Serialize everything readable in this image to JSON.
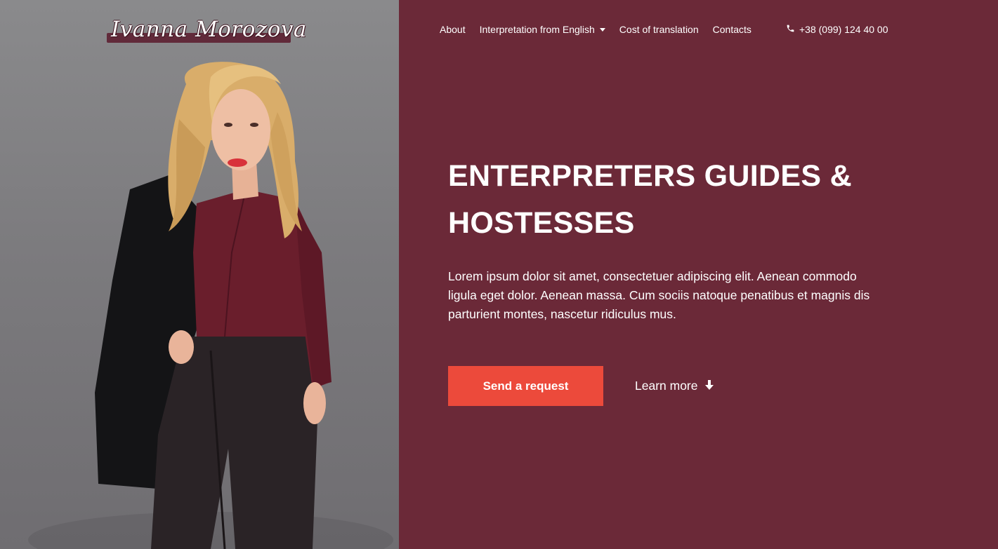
{
  "logo": {
    "text": "Ivanna Morozova"
  },
  "nav": {
    "items": [
      {
        "label": "About"
      },
      {
        "label": "Interpretation from English",
        "has_dropdown": true
      },
      {
        "label": "Cost of translation"
      },
      {
        "label": "Contacts"
      }
    ],
    "phone": "+38 (099) 124 40 00"
  },
  "hero": {
    "title": "ENTERPRETERS GUIDES & HOSTESSES",
    "text": "Lorem ipsum dolor sit amet, consectetuer adipiscing elit. Aenean commodo ligula eget dolor. Aenean massa. Cum sociis natoque penatibus et magnis dis parturient montes, nascetur ridiculus mus.",
    "primary_button": "Send a request",
    "secondary_link": "Learn more"
  },
  "icons": {
    "phone": "phone-icon",
    "dropdown": "chevron-down-icon",
    "learn_more": "arrow-down-icon"
  },
  "colors": {
    "content_background": "#6b2938",
    "photo_background": "#7f7e81",
    "accent_button": "#ec4a3b",
    "text": "#ffffff"
  }
}
